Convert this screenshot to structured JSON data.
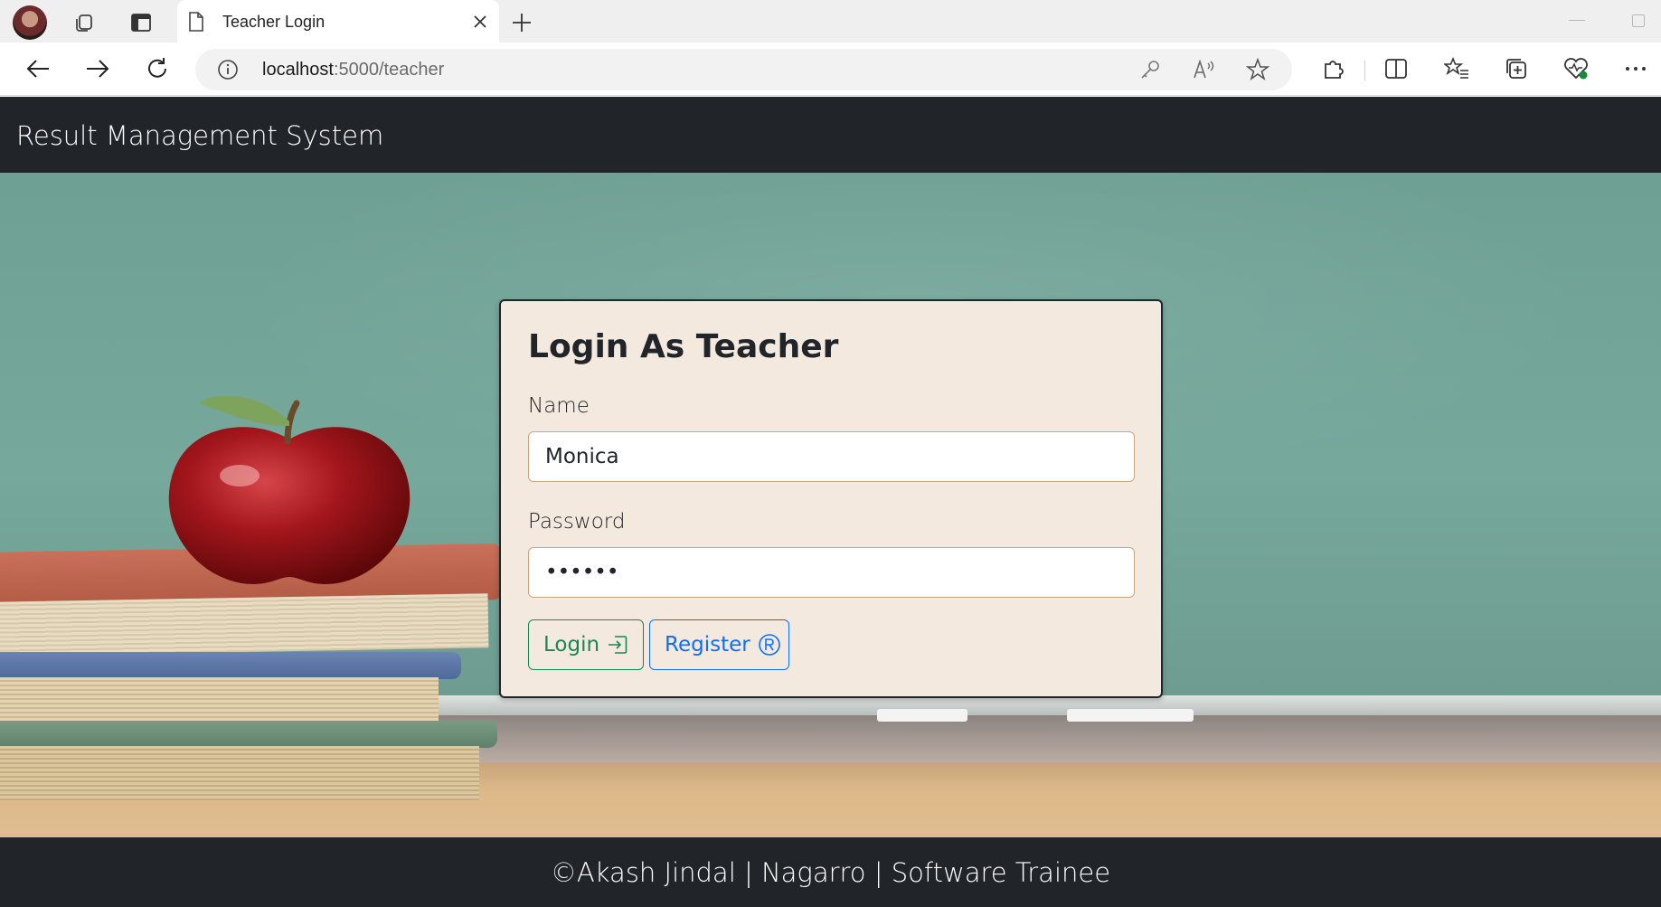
{
  "browser": {
    "tab_title": "Teacher Login",
    "url_host": "localhost",
    "url_path": ":5000/teacher"
  },
  "icons": {
    "profile": "avatar",
    "workspaces": "workspaces-icon",
    "tab_actions": "vertical-tabs-icon",
    "tab_page": "page-icon",
    "close": "close-icon",
    "new_tab": "plus-icon",
    "back": "back-arrow-icon",
    "forward": "forward-arrow-icon",
    "refresh": "refresh-icon",
    "info": "info-icon",
    "key": "key-icon",
    "read_aloud": "read-aloud-icon",
    "favorite": "star-icon",
    "extensions": "puzzle-icon",
    "split": "split-screen-icon",
    "favorites": "favorites-list-icon",
    "collections": "collections-icon",
    "health": "browser-essentials-icon",
    "more": "more-icon",
    "login": "login-arrow-icon",
    "register": "registered-icon"
  },
  "page": {
    "brand": "Result Management System",
    "card": {
      "title": "Login As Teacher",
      "name_label": "Name",
      "name_value": "Monica",
      "password_label": "Password",
      "password_value": "••••••",
      "login_label": "Login",
      "register_label": "Register"
    },
    "footer": "©Akash Jindal | Nagarro | Software Trainee"
  },
  "colors": {
    "navbar": "#212529",
    "card_bg": "#f3e9de",
    "login": "#198754",
    "register": "#0d6efd"
  }
}
